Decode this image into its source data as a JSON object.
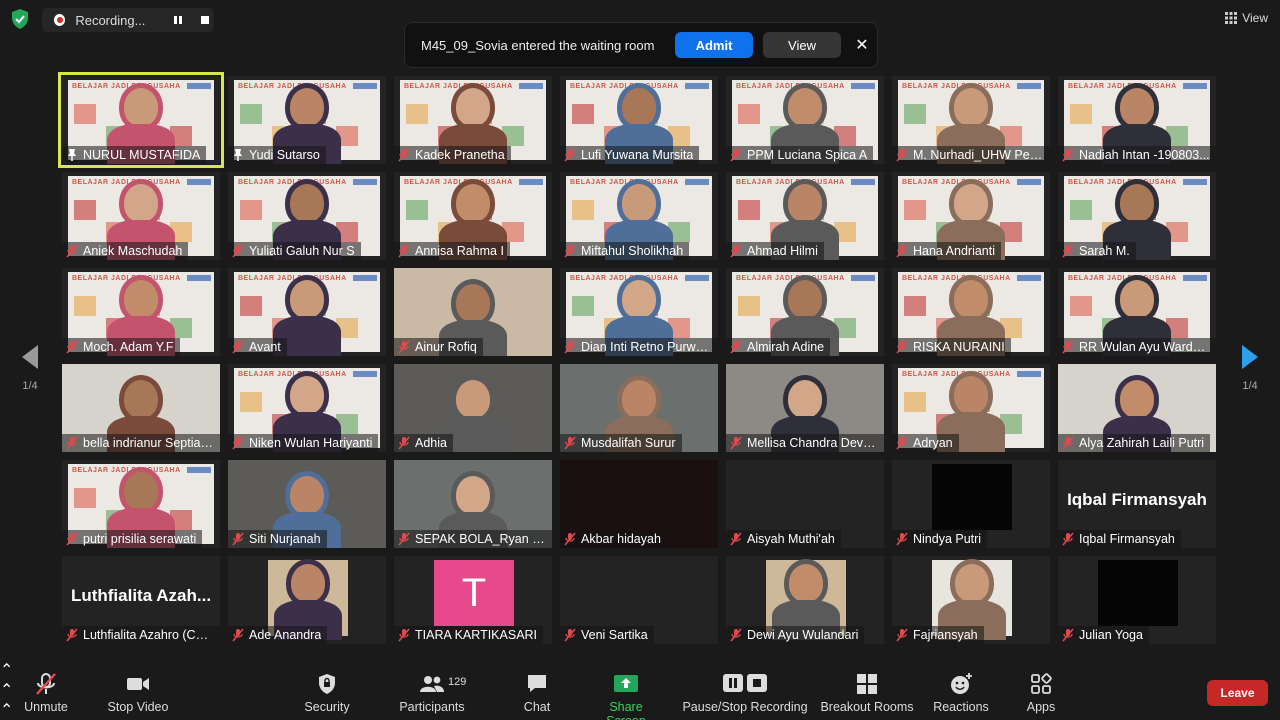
{
  "recording": {
    "label": "Recording..."
  },
  "view": {
    "label": "View"
  },
  "notification": {
    "message": "M45_09_Sovia entered the waiting room",
    "admit_label": "Admit",
    "view_label": "View",
    "close_glyph": "✕"
  },
  "pagination": {
    "left": "1/4",
    "right": "1/4"
  },
  "participants": [
    {
      "name": "NURUL MUSTAFIDA",
      "type": "banner",
      "mic": "pin"
    },
    {
      "name": "Yudi Sutarso",
      "type": "banner",
      "mic": "pin"
    },
    {
      "name": "Kadek Pranetha",
      "type": "banner",
      "mic": "muted"
    },
    {
      "name": "Lufi Yuwana Mursita",
      "type": "banner",
      "mic": "muted"
    },
    {
      "name": "PPM Luciana Spica A",
      "type": "banner",
      "mic": "muted"
    },
    {
      "name": "M. Nurhadi_UHW Perb...",
      "type": "banner",
      "mic": "muted"
    },
    {
      "name": "Nadiah Intan -190803...",
      "type": "banner",
      "mic": "muted"
    },
    {
      "name": "Aniek Maschudah",
      "type": "banner",
      "mic": "muted"
    },
    {
      "name": "Yuliati Galuh Nur S",
      "type": "banner",
      "mic": "muted"
    },
    {
      "name": "Annisa Rahma I",
      "type": "banner",
      "mic": "muted"
    },
    {
      "name": "Miftahul Sholikhah",
      "type": "banner",
      "mic": "muted"
    },
    {
      "name": "Ahmad Hilmi",
      "type": "banner",
      "mic": "muted"
    },
    {
      "name": "Hana Andrianti",
      "type": "banner",
      "mic": "muted"
    },
    {
      "name": "Sarah M.",
      "type": "banner",
      "mic": "muted"
    },
    {
      "name": "Moch. Adam Y.F",
      "type": "banner",
      "mic": "muted"
    },
    {
      "name": "Avant",
      "type": "banner",
      "mic": "muted"
    },
    {
      "name": "Ainur Rofiq",
      "type": "camera",
      "mic": "muted"
    },
    {
      "name": "Dian Inti Retno Purwa...",
      "type": "banner",
      "mic": "muted"
    },
    {
      "name": "Almirah Adine",
      "type": "banner",
      "mic": "muted"
    },
    {
      "name": "RISKA NURAINI",
      "type": "banner",
      "mic": "muted"
    },
    {
      "name": "RR Wulan Ayu Wardan...",
      "type": "banner",
      "mic": "muted"
    },
    {
      "name": "bella indrianur Septiaw...",
      "type": "camera",
      "mic": "muted"
    },
    {
      "name": "Niken Wulan Hariyanti",
      "type": "banner",
      "mic": "muted"
    },
    {
      "name": "Adhia",
      "type": "camera",
      "mic": "muted"
    },
    {
      "name": "Musdalifah Surur",
      "type": "camera",
      "mic": "muted"
    },
    {
      "name": "Mellisa Chandra Devy ...",
      "type": "camera",
      "mic": "muted"
    },
    {
      "name": "Adryan",
      "type": "banner",
      "mic": "muted"
    },
    {
      "name": "Alya Zahirah Laili Putri",
      "type": "camera",
      "mic": "muted"
    },
    {
      "name": "putri prisilia serawati",
      "type": "banner",
      "mic": "muted"
    },
    {
      "name": "Siti Nurjanah",
      "type": "camera",
      "mic": "muted"
    },
    {
      "name": "SEPAK BOLA_Ryan Wa...",
      "type": "camera",
      "mic": "muted"
    },
    {
      "name": "Akbar hidayah",
      "type": "dark",
      "mic": "muted"
    },
    {
      "name": "Aisyah Muthi'ah",
      "type": "off",
      "mic": "muted"
    },
    {
      "name": "Nindya Putri",
      "type": "black",
      "mic": "muted"
    },
    {
      "name": "Iqbal Firmansyah",
      "type": "text",
      "display": "Iqbal Firmansyah",
      "mic": "muted"
    },
    {
      "name": "Luthfialita Azahro (CB...",
      "type": "text",
      "display": "Luthfialita Azah...",
      "mic": "muted"
    },
    {
      "name": "Ade Anandra",
      "type": "photo",
      "mic": "muted"
    },
    {
      "name": "TIARA KARTIKASARI",
      "type": "letter",
      "display": "T",
      "mic": "muted"
    },
    {
      "name": "Veni Sartika",
      "type": "off",
      "mic": "muted"
    },
    {
      "name": "Dewi Ayu Wulandari",
      "type": "photo",
      "mic": "muted"
    },
    {
      "name": "Fajriansyah",
      "type": "photo",
      "mic": "muted"
    },
    {
      "name": "Julian Yoga",
      "type": "black",
      "mic": "muted"
    }
  ],
  "banner_text": "BELAJAR JADI PENGUSAHA",
  "toolbar": {
    "unmute": "Unmute",
    "stop_video": "Stop Video",
    "security": "Security",
    "participants": "Participants",
    "participant_count": "129",
    "chat": "Chat",
    "share_screen": "Share Screen",
    "recording": "Pause/Stop Recording",
    "breakout": "Breakout Rooms",
    "reactions": "Reactions",
    "apps": "Apps",
    "leave": "Leave"
  },
  "colors": {
    "accent_blue": "#0e72ed",
    "share_green": "#3ecf5e",
    "leave_red": "#c62828",
    "active_speaker": "#d7e64c",
    "mute_red": "#e5484d"
  }
}
